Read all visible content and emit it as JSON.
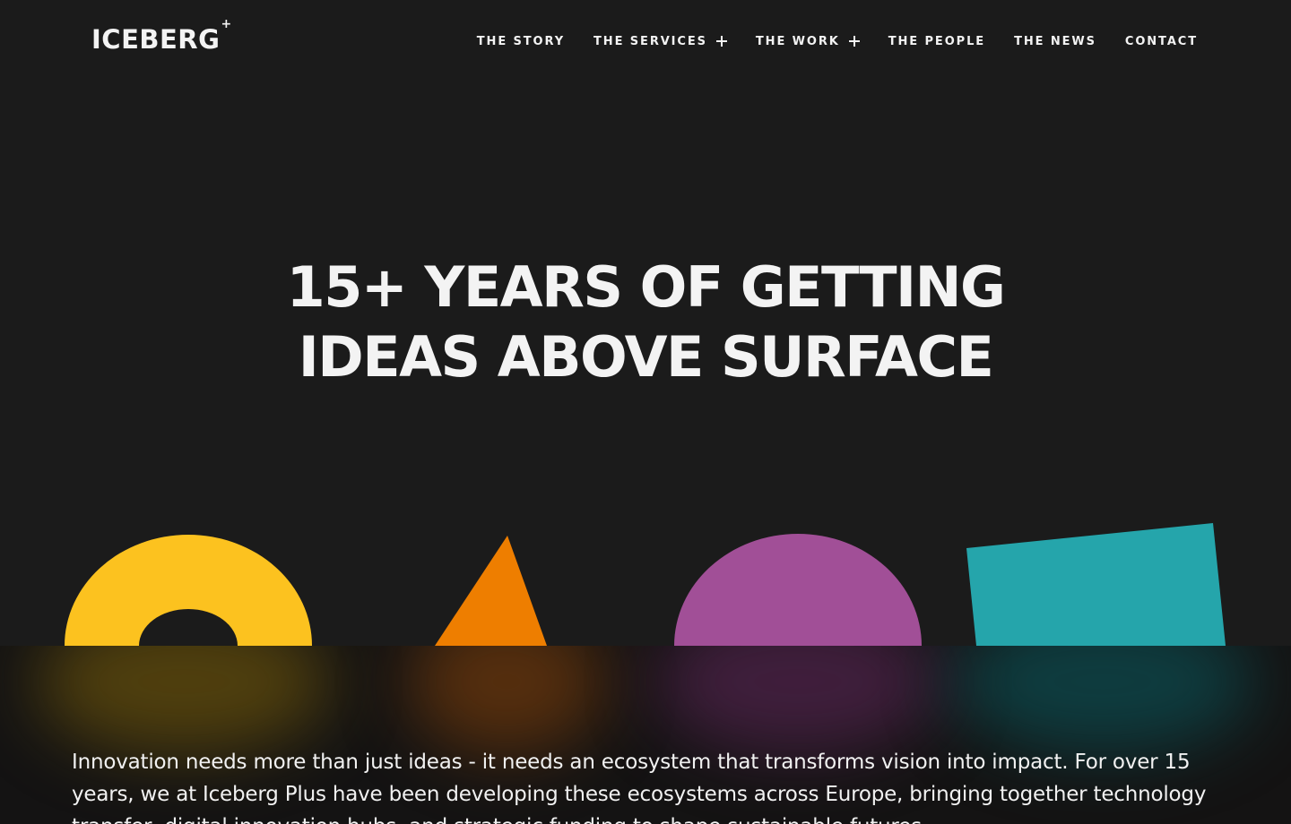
{
  "header": {
    "logo_text": "ICEBERG",
    "logo_superscript": "+",
    "nav": [
      {
        "label": "THE STORY",
        "has_submenu": false
      },
      {
        "label": "THE SERVICES",
        "has_submenu": true
      },
      {
        "label": "THE WORK",
        "has_submenu": true
      },
      {
        "label": "THE PEOPLE",
        "has_submenu": false
      },
      {
        "label": "THE NEWS",
        "has_submenu": false
      },
      {
        "label": "CONTACT",
        "has_submenu": false
      }
    ]
  },
  "hero": {
    "title_line1": "15+ YEARS OF GETTING",
    "title_line2": "IDEAS ABOVE SURFACE"
  },
  "shapes": {
    "colors": {
      "ring": "#fcc21f",
      "triangle": "#ee7e00",
      "semicircle": "#a14f97",
      "rectangle": "#25a5ab"
    }
  },
  "intro": {
    "text": "Innovation needs more than just ideas - it needs an ecosystem that transforms vision into impact. For over 15 years, we at Iceberg Plus have been developing these ecosystems across Europe, bringing together technology transfer, digital innovation hubs, and strategic funding to shape sustainable futures."
  },
  "colors": {
    "background": "#1b1b1b",
    "water": "#141313",
    "text": "#f3f3f3"
  }
}
